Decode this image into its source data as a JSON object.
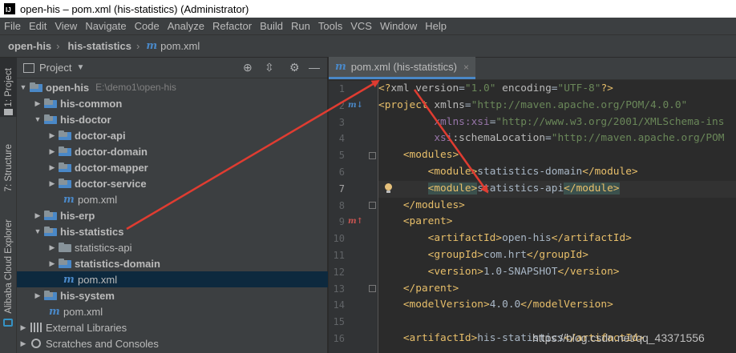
{
  "window": {
    "title": "open-his – pom.xml (his-statistics) (Administrator)",
    "logo": "IJ"
  },
  "menu": [
    "File",
    "Edit",
    "View",
    "Navigate",
    "Code",
    "Analyze",
    "Refactor",
    "Build",
    "Run",
    "Tools",
    "VCS",
    "Window",
    "Help"
  ],
  "breadcrumb": {
    "project": "open-his",
    "module": "his-statistics",
    "file": "pom.xml"
  },
  "side_tabs": {
    "project": "1: Project",
    "structure": "7: Structure",
    "alibaba": "Alibaba Cloud Explorer"
  },
  "project_panel": {
    "title": "Project",
    "dropdown_icon": "chevron-down-icon"
  },
  "tree": [
    {
      "label": "open-his",
      "path": "E:\\demo1\\open-his",
      "type": "module-root",
      "expanded": true,
      "depth": 0
    },
    {
      "label": "his-common",
      "type": "module",
      "expanded": false,
      "depth": 1
    },
    {
      "label": "his-doctor",
      "type": "module",
      "expanded": true,
      "depth": 1
    },
    {
      "label": "doctor-api",
      "type": "module",
      "expanded": false,
      "depth": 2
    },
    {
      "label": "doctor-domain",
      "type": "module",
      "expanded": false,
      "depth": 2
    },
    {
      "label": "doctor-mapper",
      "type": "module",
      "expanded": false,
      "depth": 2
    },
    {
      "label": "doctor-service",
      "type": "module",
      "expanded": false,
      "depth": 2
    },
    {
      "label": "pom.xml",
      "type": "pom",
      "depth": 2
    },
    {
      "label": "his-erp",
      "type": "module",
      "expanded": false,
      "depth": 1
    },
    {
      "label": "his-statistics",
      "type": "module",
      "expanded": true,
      "depth": 1
    },
    {
      "label": "statistics-api",
      "type": "folder",
      "expanded": false,
      "depth": 2
    },
    {
      "label": "statistics-domain",
      "type": "module",
      "expanded": false,
      "depth": 2
    },
    {
      "label": "pom.xml",
      "type": "pom",
      "depth": 2,
      "selected": true
    },
    {
      "label": "his-system",
      "type": "module",
      "expanded": false,
      "depth": 1
    },
    {
      "label": "pom.xml",
      "type": "pom",
      "depth": 1
    },
    {
      "label": "External Libraries",
      "type": "libraries",
      "expanded": false,
      "depth": 0
    },
    {
      "label": "Scratches and Consoles",
      "type": "scratches",
      "expanded": false,
      "depth": 0
    }
  ],
  "editor": {
    "tab_label": "pom.xml (his-statistics)",
    "current_line": 7,
    "lines": [
      {
        "n": "1",
        "text": "<?xml version=\"1.0\" encoding=\"UTF-8\"?>"
      },
      {
        "n": "2",
        "text": "<project xmlns=\"http://maven.apache.org/POM/4.0.0\""
      },
      {
        "n": "3",
        "text": "         xmlns:xsi=\"http://www.w3.org/2001/XMLSchema-ins"
      },
      {
        "n": "4",
        "text": "         xsi:schemaLocation=\"http://maven.apache.org/POM"
      },
      {
        "n": "5",
        "text": "    <modules>"
      },
      {
        "n": "6",
        "text": "        <module>statistics-domain</module>"
      },
      {
        "n": "7",
        "text": "        <module>statistics-api</module>"
      },
      {
        "n": "8",
        "text": "    </modules>"
      },
      {
        "n": "9",
        "text": "    <parent>"
      },
      {
        "n": "10",
        "text": "        <artifactId>open-his</artifactId>"
      },
      {
        "n": "11",
        "text": "        <groupId>com.hrt</groupId>"
      },
      {
        "n": "12",
        "text": "        <version>1.0-SNAPSHOT</version>"
      },
      {
        "n": "13",
        "text": "    </parent>"
      },
      {
        "n": "14",
        "text": "    <modelVersion>4.0.0</modelVersion>"
      },
      {
        "n": "15",
        "text": ""
      },
      {
        "n": "16",
        "text": "    <artifactId>his-statistics</artifactId>"
      }
    ]
  },
  "watermark": "https://blog.csdn.net/qq_43371556",
  "colors": {
    "accent": "#4a88c7",
    "tag": "#e8bf6a",
    "value": "#6a8759",
    "namespace": "#9876aa",
    "annotation": "#e03c31"
  }
}
